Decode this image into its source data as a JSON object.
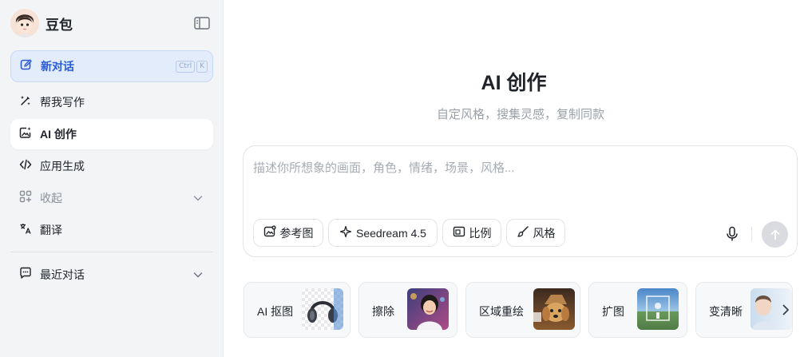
{
  "sidebar": {
    "brand_name": "豆包",
    "new_chat": {
      "label": "新对话",
      "shortcut_keys": [
        "Ctrl",
        "K"
      ]
    },
    "items": [
      {
        "label": "帮我写作",
        "icon": "pen-sparkle-icon"
      },
      {
        "label": "AI 创作",
        "icon": "image-sparkle-icon",
        "active": true
      },
      {
        "label": "应用生成",
        "icon": "code-icon"
      },
      {
        "label": "收起",
        "icon": "grid-icon",
        "muted": true
      },
      {
        "label": "翻译",
        "icon": "translate-icon"
      },
      {
        "label": "最近对话",
        "icon": "chat-bubble-icon"
      }
    ]
  },
  "main": {
    "title": "AI 创作",
    "subtitle": "自定风格，搜集灵感，复制同款",
    "composer": {
      "placeholder": "描述你所想象的画面，角色，情绪，场景，风格...",
      "chips": {
        "reference": "参考图",
        "model": "Seedream 4.5",
        "ratio": "比例",
        "style": "风格"
      }
    },
    "tools": [
      {
        "label": "AI 抠图"
      },
      {
        "label": "擦除"
      },
      {
        "label": "区域重绘"
      },
      {
        "label": "扩图"
      },
      {
        "label": "变清晰"
      }
    ]
  },
  "colors": {
    "accent": "#2a5bd7",
    "sidebar_bg": "#f3f4f6",
    "new_chat_bg": "#e3ecfb"
  }
}
